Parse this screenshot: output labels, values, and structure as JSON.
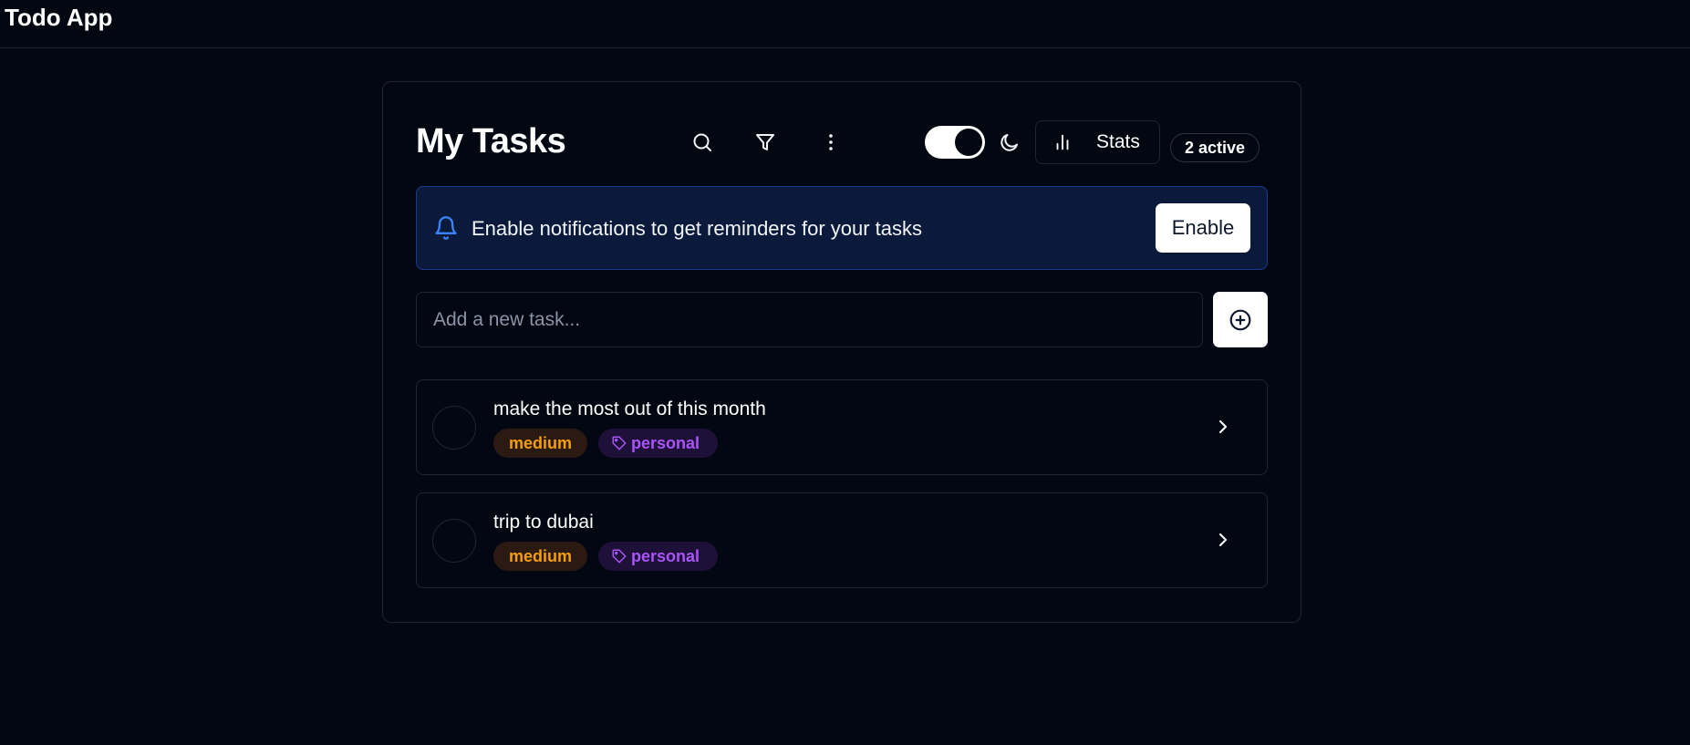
{
  "app": {
    "title": "Todo App"
  },
  "header": {
    "title": "My Tasks",
    "icons": [
      "search-icon",
      "filter-icon",
      "more-vertical-icon",
      "moon-icon",
      "bar-chart-icon"
    ],
    "stats_label": "Stats",
    "active_badge": "2 active",
    "theme_toggle_on": true
  },
  "notification": {
    "message": "Enable notifications to get reminders for your tasks",
    "button_label": "Enable",
    "icon": "bell-icon"
  },
  "new_task": {
    "placeholder": "Add a new task...",
    "value": "",
    "add_icon": "plus-circle-icon"
  },
  "tasks": [
    {
      "title": "make the most out of this month",
      "priority": "medium",
      "category": "personal",
      "completed": false
    },
    {
      "title": "trip to dubai",
      "priority": "medium",
      "category": "personal",
      "completed": false
    }
  ],
  "colors": {
    "background": "#030712",
    "notice_bg": "#0b1a3a",
    "notice_border": "#1e3a8a",
    "bell": "#3b82f6",
    "priority_medium": "#f59e0b",
    "category_personal": "#a855f7"
  }
}
